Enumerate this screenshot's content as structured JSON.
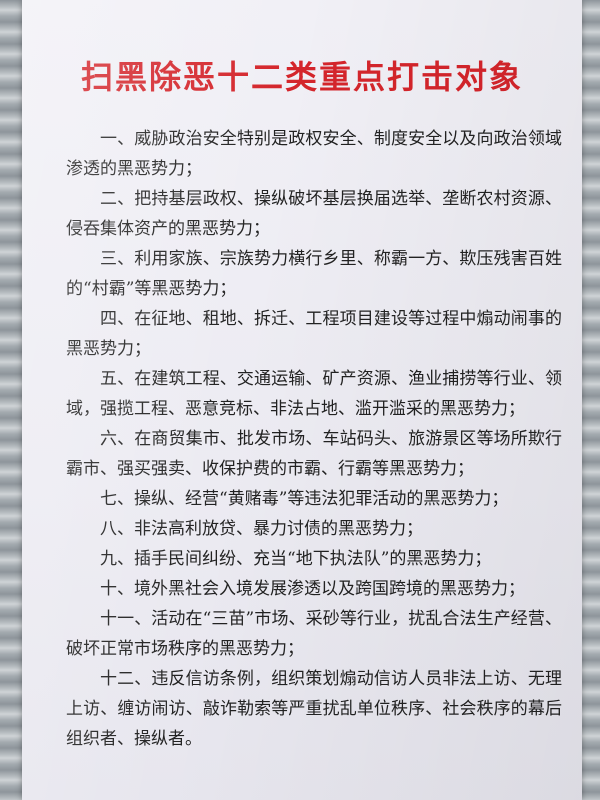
{
  "poster": {
    "title": "扫黑除恶十二类重点打击对象",
    "items": [
      "一、威胁政治安全特别是政权安全、制度安全以及向政治领域渗透的黑恶势力；",
      "二、把持基层政权、操纵破坏基层换届选举、垄断农村资源、侵吞集体资产的黑恶势力；",
      "三、利用家族、宗族势力横行乡里、称霸一方、欺压残害百姓的“村霸”等黑恶势力；",
      "四、在征地、租地、拆迁、工程项目建设等过程中煽动闹事的黑恶势力；",
      "五、在建筑工程、交通运输、矿产资源、渔业捕捞等行业、领域，强揽工程、恶意竞标、非法占地、滥开滥采的黑恶势力；",
      "六、在商贸集市、批发市场、车站码头、旅游景区等场所欺行霸市、强买强卖、收保护费的市霸、行霸等黑恶势力；",
      "七、操纵、经营“黄赌毒”等违法犯罪活动的黑恶势力；",
      "八、非法高利放贷、暴力讨债的黑恶势力；",
      "九、插手民间纠纷、充当“地下执法队”的黑恶势力；",
      "十、境外黑社会入境发展渗透以及跨国跨境的黑恶势力；",
      "十一、活动在“三苗”市场、采砂等行业，扰乱合法生产经营、破坏正常市场秩序的黑恶势力；",
      "十二、违反信访条例，组织策划煽动信访人员非法上访、无理上访、缠访闹访、敲诈勒索等严重扰乱单位秩序、社会秩序的幕后组织者、操纵者。"
    ]
  },
  "colors": {
    "title": "#d4252b",
    "text": "#222222",
    "paper": "#eeedf4",
    "wall": "#a4abb0"
  }
}
